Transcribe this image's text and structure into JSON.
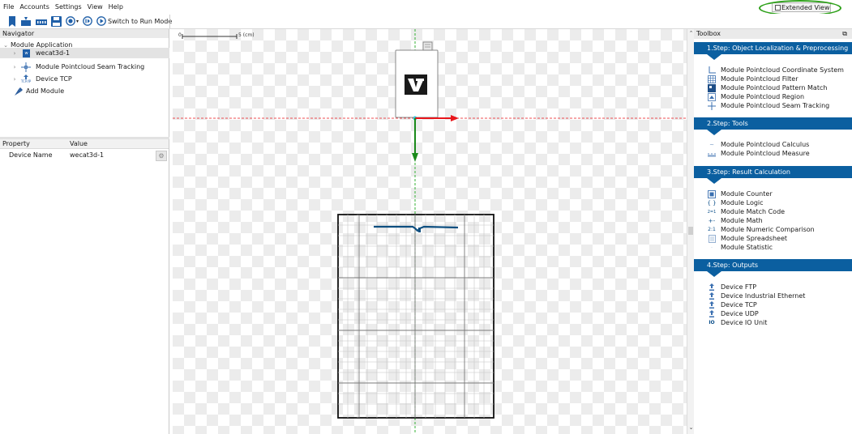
{
  "menu": [
    "File",
    "Accounts",
    "Settings",
    "View",
    "Help"
  ],
  "extended_view": {
    "label": "Extended View",
    "checked": false
  },
  "toolbar": {
    "run_mode_label": "Switch to Run Mode"
  },
  "navigator": {
    "title": "Navigator",
    "root": "Module Application",
    "items": [
      {
        "label": "wecat3d-1",
        "selected": true
      },
      {
        "label": "Module Pointcloud Seam Tracking",
        "selected": false
      },
      {
        "label": "Device TCP",
        "selected": false
      }
    ],
    "add_module": "Add Module"
  },
  "properties": {
    "headers": [
      "Property",
      "Value"
    ],
    "rows": [
      {
        "property": "Device Name",
        "value": "wecat3d-1"
      }
    ]
  },
  "canvas": {
    "scale_start": "0",
    "scale_end": "5 (cm)",
    "axis_x_color": "#e8161b",
    "axis_y_color": "#1a8a1a"
  },
  "toolbox": {
    "title": "Toolbox",
    "steps": [
      {
        "title": "1.Step: Object Localization & Preprocessing",
        "items": [
          {
            "label": "Module Pointcloud Coordinate System",
            "icon": "coordinate-system-icon"
          },
          {
            "label": "Module Pointcloud Filter",
            "icon": "filter-grid-icon"
          },
          {
            "label": "Module Pointcloud Pattern Match",
            "icon": "pattern-match-icon"
          },
          {
            "label": "Module Pointcloud Region",
            "icon": "region-icon"
          },
          {
            "label": "Module Pointcloud Seam Tracking",
            "icon": "seam-tracking-icon"
          }
        ]
      },
      {
        "title": "2.Step: Tools",
        "items": [
          {
            "label": "Module Pointcloud Calculus",
            "icon": "calculus-icon"
          },
          {
            "label": "Module Pointcloud Measure",
            "icon": "measure-icon"
          }
        ]
      },
      {
        "title": "3.Step: Result Calculation",
        "items": [
          {
            "label": "Module Counter",
            "icon": "counter-icon"
          },
          {
            "label": "Module Logic",
            "icon": "logic-icon"
          },
          {
            "label": "Module Match Code",
            "icon": "match-code-icon"
          },
          {
            "label": "Module Math",
            "icon": "math-icon"
          },
          {
            "label": "Module Numeric Comparison",
            "icon": "numeric-comparison-icon"
          },
          {
            "label": "Module Spreadsheet",
            "icon": "spreadsheet-icon"
          },
          {
            "label": "Module Statistic",
            "icon": "statistic-icon"
          }
        ]
      },
      {
        "title": "4.Step: Outputs",
        "items": [
          {
            "label": "Device FTP",
            "icon": "ftp-icon"
          },
          {
            "label": "Device Industrial Ethernet",
            "icon": "industrial-ethernet-icon"
          },
          {
            "label": "Device TCP",
            "icon": "tcp-icon"
          },
          {
            "label": "Device UDP",
            "icon": "udp-icon"
          },
          {
            "label": "Device IO Unit",
            "icon": "io-unit-icon"
          }
        ]
      }
    ]
  },
  "colors": {
    "step_header": "#0b5fa0",
    "highlight_ring": "#2fa11b",
    "profile_line": "#0e4f80"
  }
}
